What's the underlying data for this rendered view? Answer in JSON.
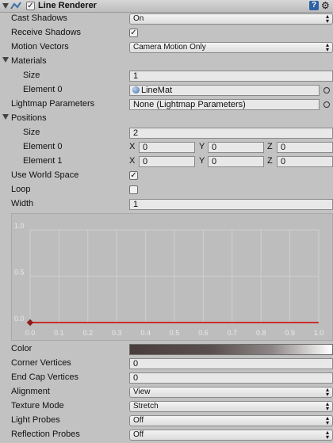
{
  "header": {
    "title": "Line Renderer",
    "enabled": true
  },
  "properties": {
    "cast_shadows": {
      "label": "Cast Shadows",
      "value": "On"
    },
    "receive_shadows": {
      "label": "Receive Shadows",
      "checked": true
    },
    "motion_vectors": {
      "label": "Motion Vectors",
      "value": "Camera Motion Only"
    },
    "materials": {
      "label": "Materials",
      "size_label": "Size",
      "size_value": "1",
      "element0_label": "Element 0",
      "element0_value": "LineMat"
    },
    "lightmap": {
      "label": "Lightmap Parameters",
      "value": "None (Lightmap Parameters)"
    },
    "positions": {
      "label": "Positions",
      "size_label": "Size",
      "size_value": "2",
      "elements": [
        {
          "label": "Element 0",
          "x": "0",
          "y": "0",
          "z": "0"
        },
        {
          "label": "Element 1",
          "x": "0",
          "y": "0",
          "z": "0"
        }
      ],
      "axis_x": "X",
      "axis_y": "Y",
      "axis_z": "Z"
    },
    "use_world_space": {
      "label": "Use World Space",
      "checked": true
    },
    "loop": {
      "label": "Loop",
      "checked": false
    },
    "width": {
      "label": "Width",
      "value": "1"
    },
    "color": {
      "label": "Color"
    },
    "corner_vertices": {
      "label": "Corner Vertices",
      "value": "0"
    },
    "end_cap_vertices": {
      "label": "End Cap Vertices",
      "value": "0"
    },
    "alignment": {
      "label": "Alignment",
      "value": "View"
    },
    "texture_mode": {
      "label": "Texture Mode",
      "value": "Stretch"
    },
    "light_probes": {
      "label": "Light Probes",
      "value": "Off"
    },
    "reflection_probes": {
      "label": "Reflection Probes",
      "value": "Off"
    }
  },
  "chart_data": {
    "type": "line",
    "x_ticks": [
      "0.0",
      "0.1",
      "0.2",
      "0.3",
      "0.4",
      "0.5",
      "0.6",
      "0.7",
      "0.8",
      "0.9",
      "1.0"
    ],
    "y_ticks": [
      "0.0",
      "0.5",
      "1.0"
    ],
    "xlim": [
      0,
      1
    ],
    "ylim": [
      0,
      1
    ],
    "series": [
      {
        "x": [
          0,
          1
        ],
        "y": [
          0,
          0
        ],
        "color": "#cc0000"
      }
    ]
  }
}
